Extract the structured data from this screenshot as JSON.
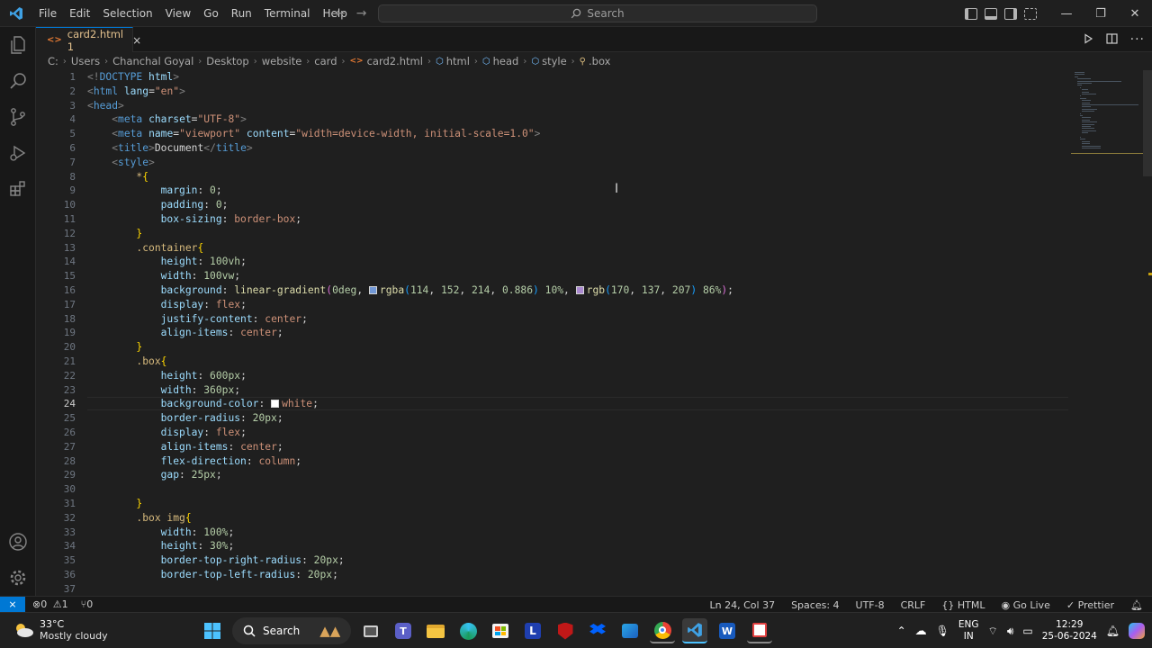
{
  "menu": [
    "File",
    "Edit",
    "Selection",
    "View",
    "Go",
    "Run",
    "Terminal",
    "Help"
  ],
  "search": {
    "label": "Search"
  },
  "tab": {
    "icon": "<>",
    "label": "card2.html",
    "problems": "1",
    "close": "×"
  },
  "breadcrumbs": [
    "C:",
    "Users",
    "Chanchal Goyal",
    "Desktop",
    "website",
    "card",
    "card2.html",
    "html",
    "head",
    "style",
    ".box"
  ],
  "editor": {
    "active_line": 24,
    "line_numbers": [
      1,
      2,
      3,
      4,
      5,
      6,
      7,
      8,
      9,
      10,
      11,
      12,
      13,
      14,
      15,
      16,
      17,
      18,
      19,
      20,
      21,
      22,
      23,
      24,
      25,
      26,
      27,
      28,
      29,
      30,
      31,
      32,
      33,
      34,
      35,
      36,
      37
    ],
    "colors": {
      "swatch1": "#7298d6",
      "swatch2": "#aa89cf",
      "swatch3": "#ffffff"
    }
  },
  "status": {
    "errors": "0",
    "warnings": "1",
    "ports": "0",
    "position": "Ln 24, Col 37",
    "spaces": "Spaces: 4",
    "encoding": "UTF-8",
    "eol": "CRLF",
    "language": "HTML",
    "golive": "Go Live",
    "prettier": "Prettier"
  },
  "taskbar": {
    "temp": "33°C",
    "weather": "Mostly cloudy",
    "search": "Search",
    "lang1": "ENG",
    "lang2": "IN",
    "time": "12:29",
    "date": "25-06-2024"
  }
}
